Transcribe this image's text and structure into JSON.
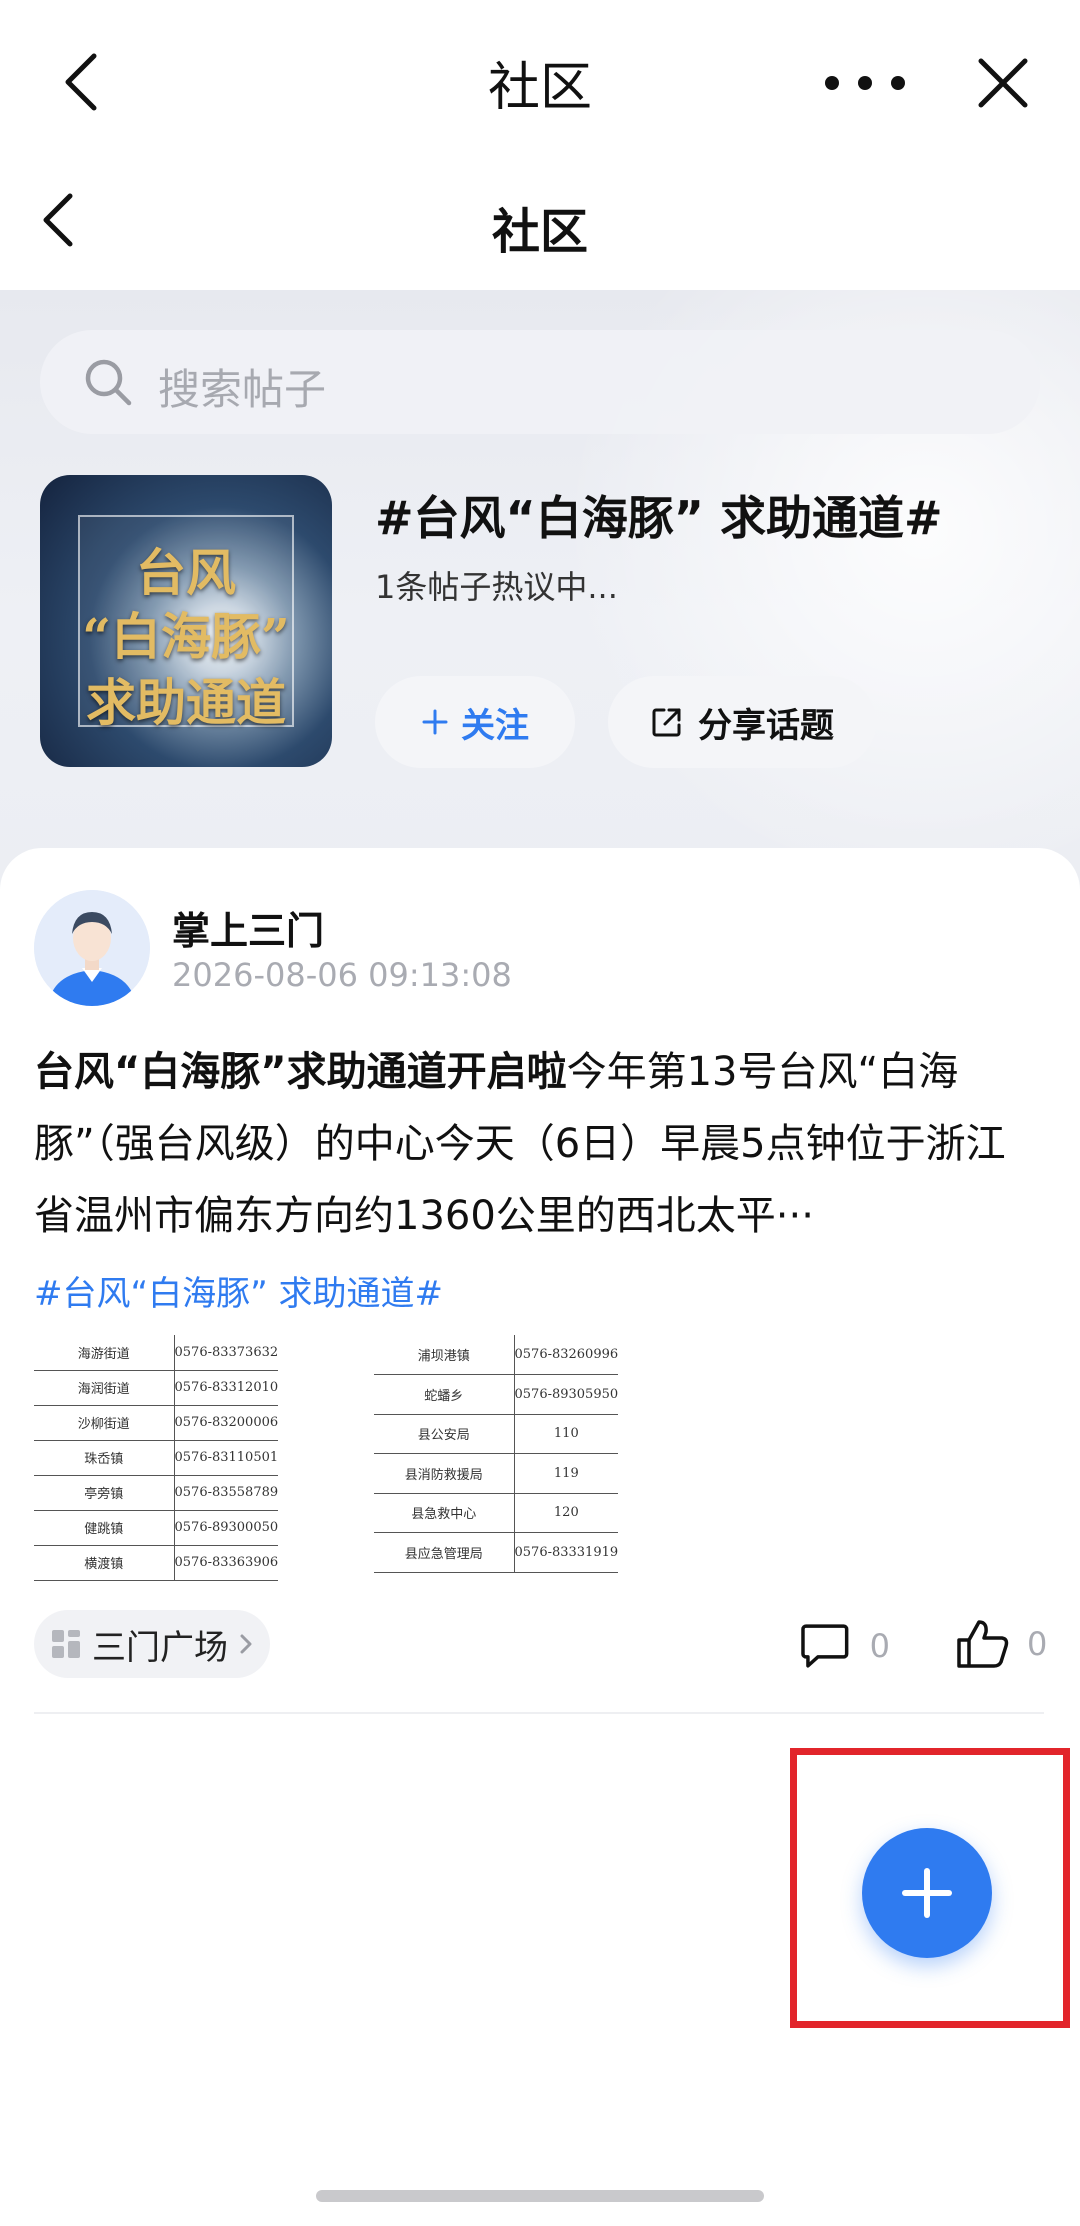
{
  "window": {
    "title": "社区",
    "more_icon": "more-icon",
    "close_icon": "close-icon",
    "back_icon": "back-icon"
  },
  "page": {
    "title": "社区"
  },
  "search": {
    "placeholder": "搜索帖子"
  },
  "topic": {
    "cover_line1": "台风",
    "cover_line2": "“白海豚”",
    "cover_line3": "求助通道",
    "title": "#台风“白海豚” 求助通道#",
    "subtitle": "1条帖子热议中...",
    "follow_label": "关注",
    "share_label": "分享话题"
  },
  "post": {
    "author": "掌上三门",
    "time": "2026-08-06 09:13:08",
    "headline": "台风“白海豚”求助通道开启啦",
    "body": "今年第13号台风“白海豚”（强台风级）的中心今天（6日）早晨5点钟位于浙江省温州市偏东方向约1360公里的西北太平···",
    "tag": "#台风“白海豚” 求助通道#",
    "table_left": [
      [
        "海游街道",
        "0576-83373632"
      ],
      [
        "海润街道",
        "0576-83312010"
      ],
      [
        "沙柳街道",
        "0576-83200006"
      ],
      [
        "珠岙镇",
        "0576-83110501"
      ],
      [
        "亭旁镇",
        "0576-83558789"
      ],
      [
        "健跳镇",
        "0576-89300050"
      ],
      [
        "横渡镇",
        "0576-83363906"
      ]
    ],
    "table_right": [
      [
        "浦坝港镇",
        "0576-83260996"
      ],
      [
        "蛇蟠乡",
        "0576-89305950"
      ],
      [
        "县公安局",
        "110"
      ],
      [
        "县消防救援局",
        "119"
      ],
      [
        "县急救中心",
        "120"
      ],
      [
        "县应急管理局",
        "0576-83331919"
      ]
    ],
    "circle": "三门广场",
    "comment_count": "0",
    "like_count": "0"
  },
  "colors": {
    "accent": "#2f7bf0",
    "highlight": "#e2252b",
    "muted": "#a9abb2"
  }
}
